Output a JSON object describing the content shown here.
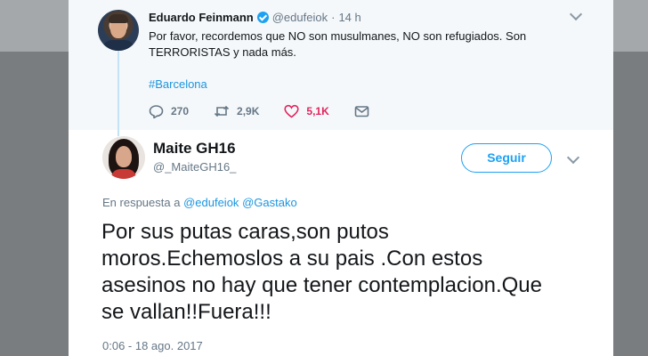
{
  "parent_tweet": {
    "author_name": "Eduardo Feinmann",
    "verified": true,
    "handle": "@edufeiok",
    "separator": "·",
    "time": "14 h",
    "text": "Por favor, recordemos que NO son musulmanes, NO son refugiados. Son TERRORISTAS y nada más.",
    "hashtag": "#Barcelona",
    "actions": {
      "replies": "270",
      "retweets": "2,9K",
      "likes": "5,1K"
    }
  },
  "main_tweet": {
    "author_name": "Maite GH16",
    "handle": "@_MaiteGH16_",
    "follow_label": "Seguir",
    "reply_prefix": "En respuesta a",
    "reply_mentions": [
      "@edufeiok",
      "@Gastako"
    ],
    "text": "Por sus putas caras,son putos moros.Echemoslos a su pais .Con estos asesinos no hay que tener contemplacion.Que se vallan!!Fuera!!!",
    "timestamp": "0:06 - 18 ago. 2017"
  },
  "colors": {
    "accent": "#1da1f2",
    "link": "#1b95e0",
    "like": "#e0245e",
    "muted": "#657786",
    "parent_background": "#f5f8fa"
  },
  "icons": [
    "verified-badge-icon",
    "chevron-down-icon",
    "reply-icon",
    "retweet-icon",
    "like-icon",
    "direct-message-icon"
  ]
}
